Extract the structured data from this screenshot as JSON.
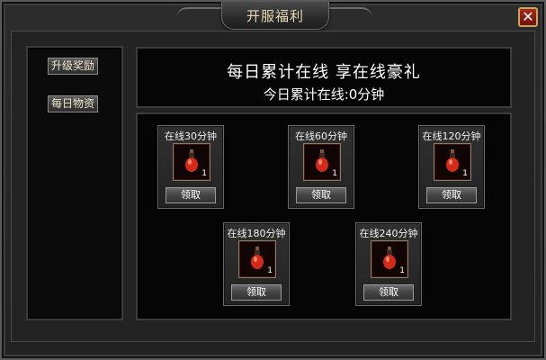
{
  "window": {
    "title": "开服福利",
    "close_symbol": "✕"
  },
  "sidebar": {
    "items": [
      {
        "label": "升级奖励"
      },
      {
        "label": "每日物资"
      }
    ]
  },
  "banner": {
    "title": "每日累计在线 享在线豪礼",
    "subtitle": "今日累计在线:0分钟"
  },
  "rewards": [
    {
      "title": "在线30分钟",
      "quantity": "1",
      "button": "领取",
      "icon": "red-potion-icon"
    },
    {
      "title": "在线60分钟",
      "quantity": "1",
      "button": "领取",
      "icon": "red-potion-icon"
    },
    {
      "title": "在线120分钟",
      "quantity": "1",
      "button": "领取",
      "icon": "red-potion-icon"
    },
    {
      "title": "在线180分钟",
      "quantity": "1",
      "button": "领取",
      "icon": "red-potion-icon"
    },
    {
      "title": "在线240分钟",
      "quantity": "1",
      "button": "领取",
      "icon": "red-potion-icon"
    }
  ],
  "colors": {
    "title_text": "#e7d8b6",
    "close_button": "#a32a1c",
    "potion_red": "#d42a1a"
  }
}
